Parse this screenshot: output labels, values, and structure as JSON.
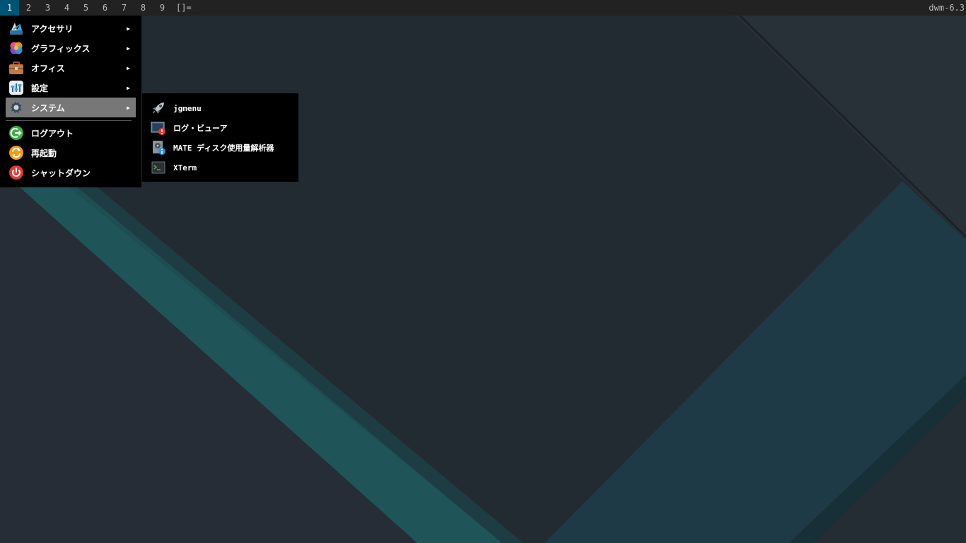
{
  "bar": {
    "tags": [
      "1",
      "2",
      "3",
      "4",
      "5",
      "6",
      "7",
      "8",
      "9"
    ],
    "selected_tag": "1",
    "layout_symbol": "[]=",
    "status": "dwm-6.3"
  },
  "menu": {
    "items": [
      {
        "label": "アクセサリ",
        "icon": "accessories-icon",
        "submenu": true
      },
      {
        "label": "グラフィックス",
        "icon": "graphics-icon",
        "submenu": true
      },
      {
        "label": "オフィス",
        "icon": "office-briefcase-icon",
        "submenu": true
      },
      {
        "label": "設定",
        "icon": "settings-icon",
        "submenu": true
      },
      {
        "label": "システム",
        "icon": "system-gear-icon",
        "submenu": true,
        "active": true
      },
      {
        "label": "ログアウト",
        "icon": "logout-icon",
        "submenu": false
      },
      {
        "label": "再起動",
        "icon": "reboot-icon",
        "submenu": false
      },
      {
        "label": "シャットダウン",
        "icon": "power-icon",
        "submenu": false
      }
    ],
    "arrow": "▶"
  },
  "submenu": {
    "items": [
      {
        "label": "jgmenu",
        "icon": "rocket-icon"
      },
      {
        "label": "ログ・ビューア",
        "icon": "log-viewer-icon"
      },
      {
        "label": "MATE ディスク使用量解析器",
        "icon": "disk-analyzer-icon"
      },
      {
        "label": "XTerm",
        "icon": "terminal-icon"
      }
    ]
  },
  "colors": {
    "bar_bg": "#222222",
    "tag_selected": "#005577",
    "menu_bg": "#000000",
    "menu_active": "#777777",
    "wallpaper_dark": "#232a32",
    "wallpaper_teal": "#1e5a5c"
  }
}
